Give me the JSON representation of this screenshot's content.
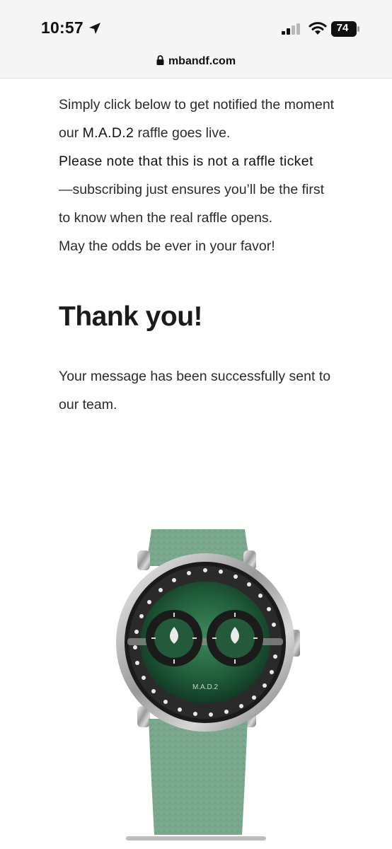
{
  "status_bar": {
    "time": "10:57",
    "battery": "74"
  },
  "browser": {
    "url": "mbandf.com"
  },
  "content": {
    "intro_line1": "Simply click below to get notified the moment",
    "intro_line2_pre": "our ",
    "intro_line2_bold": "M.A.D.2",
    "intro_line2_post": " raffle goes live.",
    "note": "Please note that this is not a raffle ticket",
    "line4": "—subscribing just ensures you’ll be the first",
    "line5": "to know when the real raffle opens.",
    "line6": "May the odds be ever in your favor!",
    "thank_you": "Thank you!",
    "message_line1": "Your message has been successfully sent to",
    "message_line2": "our team."
  },
  "watch": {
    "brand_text": "M.A.D.2",
    "strap_color": "#7aa98d",
    "dial_color": "#1f5b39"
  },
  "icons": [
    "location-arrow-icon",
    "signal-icon",
    "wifi-icon",
    "battery-icon",
    "lock-icon"
  ]
}
